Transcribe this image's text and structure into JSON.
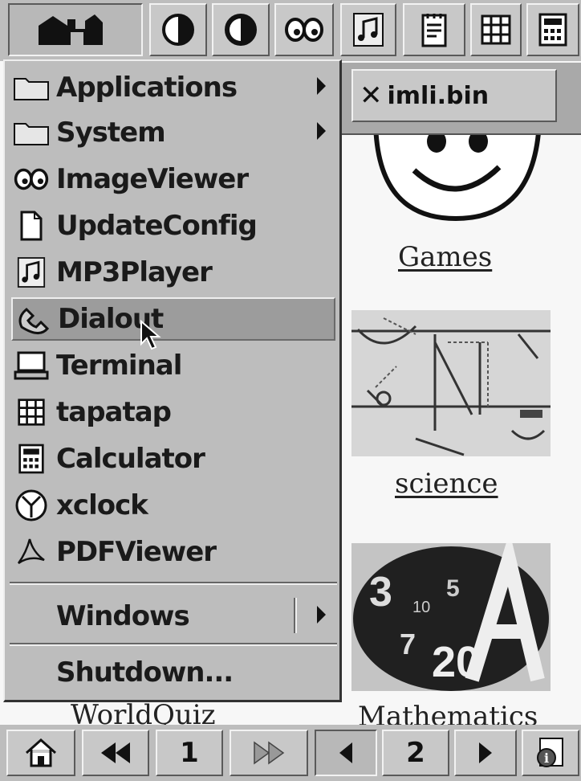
{
  "toolbar": {
    "buttons": [
      {
        "name": "home-folder-button",
        "icon": "house-icon"
      },
      {
        "name": "contrast-light-button",
        "icon": "contrast-half-icon"
      },
      {
        "name": "contrast-dark-button",
        "icon": "contrast-dark-icon"
      },
      {
        "name": "imageviewer-launcher",
        "icon": "eyes-icon"
      },
      {
        "name": "mp3player-launcher",
        "icon": "music-note-icon"
      },
      {
        "name": "notes-launcher",
        "icon": "notepad-icon"
      },
      {
        "name": "tapatap-launcher",
        "icon": "grid-icon"
      },
      {
        "name": "calculator-launcher",
        "icon": "calculator-icon"
      }
    ]
  },
  "window_tab": {
    "close_glyph": "✕",
    "title": "imli.bin"
  },
  "menu": {
    "items": [
      {
        "label": "Applications",
        "icon": "folder-icon",
        "submenu": true
      },
      {
        "label": "System",
        "icon": "folder-icon",
        "submenu": true
      },
      {
        "label": "ImageViewer",
        "icon": "eyes-icon"
      },
      {
        "label": "UpdateConfig",
        "icon": "document-icon"
      },
      {
        "label": "MP3Player",
        "icon": "music-note-icon"
      },
      {
        "label": "Dialout",
        "icon": "phone-icon",
        "selected": true
      },
      {
        "label": "Terminal",
        "icon": "computer-icon"
      },
      {
        "label": "tapatap",
        "icon": "grid-icon"
      },
      {
        "label": "Calculator",
        "icon": "calculator-icon"
      },
      {
        "label": "xclock",
        "icon": "clock-icon"
      },
      {
        "label": "PDFViewer",
        "icon": "pdf-icon"
      }
    ],
    "windows_label": "Windows",
    "shutdown_label": "Shutdown..."
  },
  "desktop": {
    "icons": [
      {
        "label": "Games",
        "image": "smiley-face"
      },
      {
        "label": "science",
        "image": "physics-diagram"
      },
      {
        "label": "Mathematics",
        "image": "numbers-ball"
      },
      {
        "label": "WorldQuiz",
        "image": "globe"
      }
    ]
  },
  "bottombar": {
    "page1": "1",
    "page2": "2"
  }
}
